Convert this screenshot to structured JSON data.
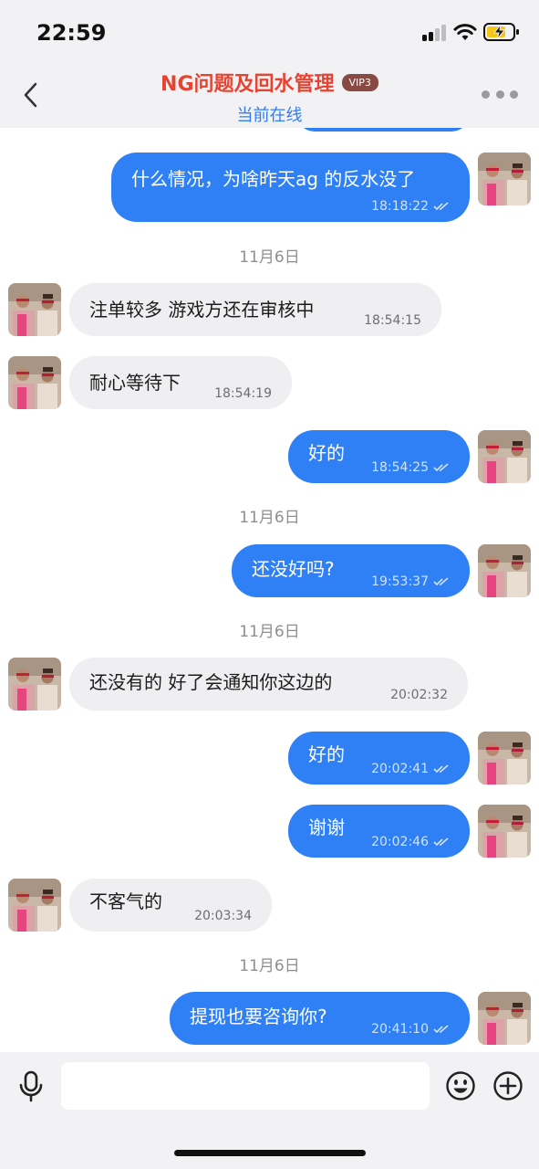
{
  "status_bar": {
    "time": "22:59"
  },
  "header": {
    "title": "NG问题及回水管理",
    "vip_badge": "VIP3",
    "subtitle": "当前在线"
  },
  "messages": [
    {
      "side": "out",
      "text": "什么情况，为啥昨天ag 的反水没了",
      "time": "18:18:22",
      "read": true
    },
    {
      "side": "date",
      "text": "11月6日"
    },
    {
      "side": "in",
      "text": "注单较多 游戏方还在审核中",
      "time": "18:54:15"
    },
    {
      "side": "in",
      "text": "耐心等待下",
      "time": "18:54:19"
    },
    {
      "side": "out",
      "text": "好的",
      "time": "18:54:25",
      "read": true
    },
    {
      "side": "date",
      "text": "11月6日"
    },
    {
      "side": "out",
      "text": "还没好吗?",
      "time": "19:53:37",
      "read": true
    },
    {
      "side": "date",
      "text": "11月6日"
    },
    {
      "side": "in",
      "text": "还没有的  好了会通知你这边的",
      "time": "20:02:32"
    },
    {
      "side": "out",
      "text": "好的",
      "time": "20:02:41",
      "read": true
    },
    {
      "side": "out",
      "text": "谢谢",
      "time": "20:02:46",
      "read": true
    },
    {
      "side": "in",
      "text": "不客气的",
      "time": "20:03:34"
    },
    {
      "side": "date",
      "text": "11月6日"
    },
    {
      "side": "out",
      "text": "提现也要咨询你?",
      "time": "20:41:10",
      "read": true
    }
  ],
  "input": {
    "placeholder": ""
  },
  "colors": {
    "accent_blue": "#2f80f5",
    "title_red": "#e74332",
    "incoming_bubble": "#efeff1"
  },
  "icons": [
    "back-chevron-icon",
    "more-dots-icon",
    "microphone-icon",
    "emoji-icon",
    "plus-circle-icon",
    "read-check-icon"
  ]
}
